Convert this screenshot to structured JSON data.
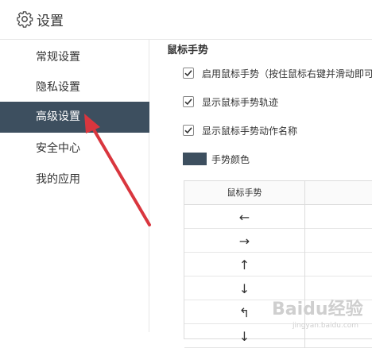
{
  "header": {
    "title": "设置",
    "icon": "gear-icon"
  },
  "sidebar": {
    "items": [
      {
        "label": "常规设置"
      },
      {
        "label": "隐私设置"
      },
      {
        "label": "高级设置",
        "active": true
      },
      {
        "label": "安全中心"
      },
      {
        "label": "我的应用"
      }
    ]
  },
  "main": {
    "section_title": "鼠标手势",
    "options": [
      {
        "label": "启用鼠标手势（按住鼠标右键并滑动即可",
        "checked": true
      },
      {
        "label": "显示鼠标手势轨迹",
        "checked": true
      },
      {
        "label": "显示鼠标手势动作名称",
        "checked": true
      }
    ],
    "color_label": "手势颜色",
    "color_value": "#3d4f5f",
    "table": {
      "header": "鼠标手势",
      "rows": [
        {
          "arrow": "←",
          "icon": "arrow-left-icon"
        },
        {
          "arrow": "→",
          "icon": "arrow-right-icon"
        },
        {
          "arrow": "↑",
          "icon": "arrow-up-icon"
        },
        {
          "arrow": "↓",
          "icon": "arrow-down-icon"
        },
        {
          "arrow": "↰",
          "icon": "arrow-up-left-turn-icon"
        },
        {
          "arrow": "↓",
          "icon": "arrow-down-icon"
        }
      ]
    }
  },
  "watermark": {
    "text": "Baidu经验",
    "subtext": "jingyan.baidu.com"
  },
  "colors": {
    "active_bg": "#3d4f5f",
    "annotation": "#d9363e"
  }
}
